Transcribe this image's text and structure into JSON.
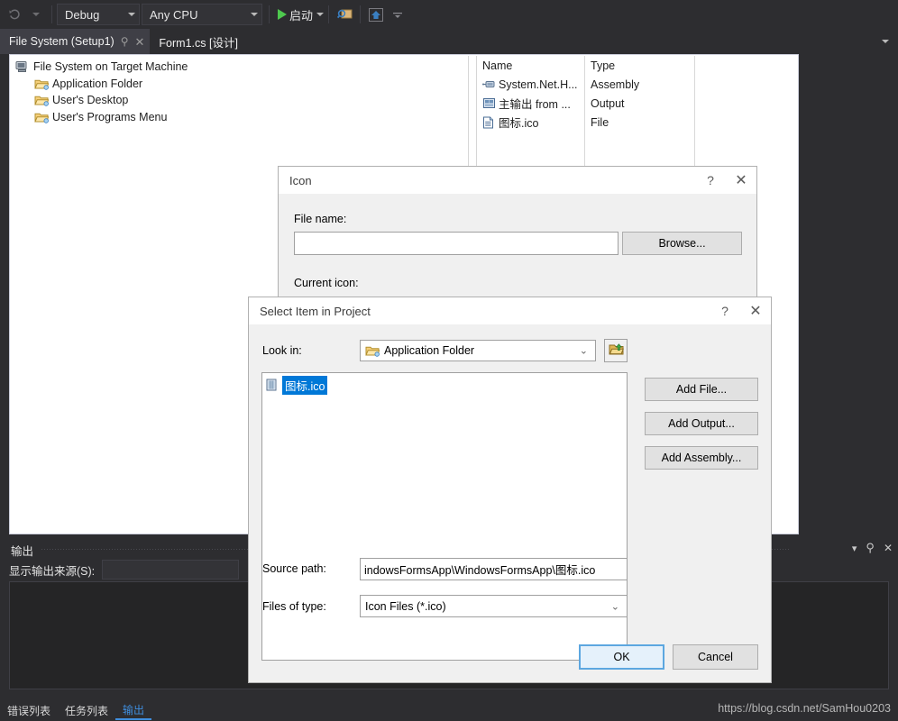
{
  "toolbar": {
    "back_icon": "undo-icon",
    "config_label": "Debug",
    "platform_label": "Any CPU",
    "run_label": "启动",
    "play_icon": "play-icon",
    "attach_icon": "attach-to-process-icon",
    "home_icon": "home-icon",
    "overflow_icon": "toolbar-overflow-icon"
  },
  "tabs": {
    "items": [
      {
        "label": "File System (Setup1)",
        "active": true,
        "pin": "📌",
        "close": "✕"
      },
      {
        "label": "Form1.cs [设计]",
        "active": false
      }
    ],
    "overflow_icon": "tab-overflow-caret"
  },
  "tree": {
    "items": [
      {
        "label": "File System on Target Machine",
        "icon": "computer-icon",
        "level": 0
      },
      {
        "label": "Application Folder",
        "icon": "folder-icon",
        "level": 1
      },
      {
        "label": "User's Desktop",
        "icon": "folder-icon",
        "level": 1
      },
      {
        "label": "User's Programs Menu",
        "icon": "folder-icon",
        "level": 1
      }
    ]
  },
  "filelist": {
    "headers": [
      "Name",
      "Type"
    ],
    "rows": [
      {
        "name": "System.Net.H...",
        "type": "Assembly",
        "icon": "assembly-icon"
      },
      {
        "name": "主输出 from ...",
        "type": "Output",
        "icon": "output-icon"
      },
      {
        "name": "图标.ico",
        "type": "File",
        "icon": "file-icon"
      }
    ]
  },
  "icon_dialog": {
    "title": "Icon",
    "help_label": "?",
    "close_label": "✕",
    "file_name_label": "File name:",
    "file_name_value": "",
    "browse_label": "Browse...",
    "current_icon_label": "Current icon:"
  },
  "select_dialog": {
    "title": "Select Item in Project",
    "help_label": "?",
    "close_label": "✕",
    "look_in_label": "Look in:",
    "look_in_value": "Application Folder",
    "look_in_icon": "folder-icon",
    "up_folder_icon": "up-one-level-icon",
    "list_items": [
      {
        "label": "图标.ico",
        "icon": "ico-file-icon",
        "selected": true
      }
    ],
    "side_buttons": [
      {
        "label": "Add File..."
      },
      {
        "label": "Add Output..."
      },
      {
        "label": "Add Assembly..."
      }
    ],
    "source_path_label": "Source path:",
    "source_path_value": "indowsFormsApp\\WindowsFormsApp\\图标.ico",
    "files_of_type_label": "Files of type:",
    "files_of_type_value": "Icon Files (*.ico)",
    "ok_label": "OK",
    "cancel_label": "Cancel"
  },
  "output_pane": {
    "title": "输出",
    "source_label": "显示输出来源(S):",
    "source_value": "",
    "dropdown_icon": "chevron-down-icon",
    "pin_icon": "pin-icon",
    "close_icon": "close-icon"
  },
  "statusbar": {
    "tabs": [
      {
        "label": "错误列表",
        "selected": false
      },
      {
        "label": "任务列表",
        "selected": false
      },
      {
        "label": "输出",
        "selected": true
      }
    ]
  },
  "watermark": {
    "text": "https://blog.csdn.net/SamHou0203"
  },
  "colors": {
    "chrome_bg": "#2d2d30",
    "accent_blue": "#3f8ddc",
    "selection_blue": "#0078d7",
    "default_button_border": "#5ca7e0"
  }
}
